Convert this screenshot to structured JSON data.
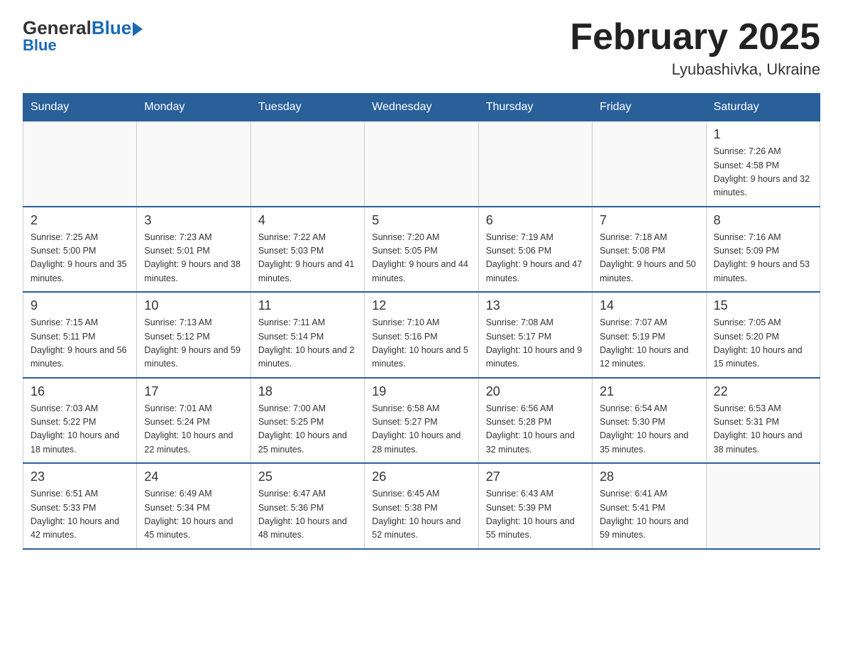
{
  "header": {
    "logo_general": "General",
    "logo_blue": "Blue",
    "title": "February 2025",
    "subtitle": "Lyubashivka, Ukraine"
  },
  "days_of_week": [
    "Sunday",
    "Monday",
    "Tuesday",
    "Wednesday",
    "Thursday",
    "Friday",
    "Saturday"
  ],
  "weeks": [
    [
      {
        "day": "",
        "info": ""
      },
      {
        "day": "",
        "info": ""
      },
      {
        "day": "",
        "info": ""
      },
      {
        "day": "",
        "info": ""
      },
      {
        "day": "",
        "info": ""
      },
      {
        "day": "",
        "info": ""
      },
      {
        "day": "1",
        "info": "Sunrise: 7:26 AM\nSunset: 4:58 PM\nDaylight: 9 hours and 32 minutes."
      }
    ],
    [
      {
        "day": "2",
        "info": "Sunrise: 7:25 AM\nSunset: 5:00 PM\nDaylight: 9 hours and 35 minutes."
      },
      {
        "day": "3",
        "info": "Sunrise: 7:23 AM\nSunset: 5:01 PM\nDaylight: 9 hours and 38 minutes."
      },
      {
        "day": "4",
        "info": "Sunrise: 7:22 AM\nSunset: 5:03 PM\nDaylight: 9 hours and 41 minutes."
      },
      {
        "day": "5",
        "info": "Sunrise: 7:20 AM\nSunset: 5:05 PM\nDaylight: 9 hours and 44 minutes."
      },
      {
        "day": "6",
        "info": "Sunrise: 7:19 AM\nSunset: 5:06 PM\nDaylight: 9 hours and 47 minutes."
      },
      {
        "day": "7",
        "info": "Sunrise: 7:18 AM\nSunset: 5:08 PM\nDaylight: 9 hours and 50 minutes."
      },
      {
        "day": "8",
        "info": "Sunrise: 7:16 AM\nSunset: 5:09 PM\nDaylight: 9 hours and 53 minutes."
      }
    ],
    [
      {
        "day": "9",
        "info": "Sunrise: 7:15 AM\nSunset: 5:11 PM\nDaylight: 9 hours and 56 minutes."
      },
      {
        "day": "10",
        "info": "Sunrise: 7:13 AM\nSunset: 5:12 PM\nDaylight: 9 hours and 59 minutes."
      },
      {
        "day": "11",
        "info": "Sunrise: 7:11 AM\nSunset: 5:14 PM\nDaylight: 10 hours and 2 minutes."
      },
      {
        "day": "12",
        "info": "Sunrise: 7:10 AM\nSunset: 5:16 PM\nDaylight: 10 hours and 5 minutes."
      },
      {
        "day": "13",
        "info": "Sunrise: 7:08 AM\nSunset: 5:17 PM\nDaylight: 10 hours and 9 minutes."
      },
      {
        "day": "14",
        "info": "Sunrise: 7:07 AM\nSunset: 5:19 PM\nDaylight: 10 hours and 12 minutes."
      },
      {
        "day": "15",
        "info": "Sunrise: 7:05 AM\nSunset: 5:20 PM\nDaylight: 10 hours and 15 minutes."
      }
    ],
    [
      {
        "day": "16",
        "info": "Sunrise: 7:03 AM\nSunset: 5:22 PM\nDaylight: 10 hours and 18 minutes."
      },
      {
        "day": "17",
        "info": "Sunrise: 7:01 AM\nSunset: 5:24 PM\nDaylight: 10 hours and 22 minutes."
      },
      {
        "day": "18",
        "info": "Sunrise: 7:00 AM\nSunset: 5:25 PM\nDaylight: 10 hours and 25 minutes."
      },
      {
        "day": "19",
        "info": "Sunrise: 6:58 AM\nSunset: 5:27 PM\nDaylight: 10 hours and 28 minutes."
      },
      {
        "day": "20",
        "info": "Sunrise: 6:56 AM\nSunset: 5:28 PM\nDaylight: 10 hours and 32 minutes."
      },
      {
        "day": "21",
        "info": "Sunrise: 6:54 AM\nSunset: 5:30 PM\nDaylight: 10 hours and 35 minutes."
      },
      {
        "day": "22",
        "info": "Sunrise: 6:53 AM\nSunset: 5:31 PM\nDaylight: 10 hours and 38 minutes."
      }
    ],
    [
      {
        "day": "23",
        "info": "Sunrise: 6:51 AM\nSunset: 5:33 PM\nDaylight: 10 hours and 42 minutes."
      },
      {
        "day": "24",
        "info": "Sunrise: 6:49 AM\nSunset: 5:34 PM\nDaylight: 10 hours and 45 minutes."
      },
      {
        "day": "25",
        "info": "Sunrise: 6:47 AM\nSunset: 5:36 PM\nDaylight: 10 hours and 48 minutes."
      },
      {
        "day": "26",
        "info": "Sunrise: 6:45 AM\nSunset: 5:38 PM\nDaylight: 10 hours and 52 minutes."
      },
      {
        "day": "27",
        "info": "Sunrise: 6:43 AM\nSunset: 5:39 PM\nDaylight: 10 hours and 55 minutes."
      },
      {
        "day": "28",
        "info": "Sunrise: 6:41 AM\nSunset: 5:41 PM\nDaylight: 10 hours and 59 minutes."
      },
      {
        "day": "",
        "info": ""
      }
    ]
  ]
}
